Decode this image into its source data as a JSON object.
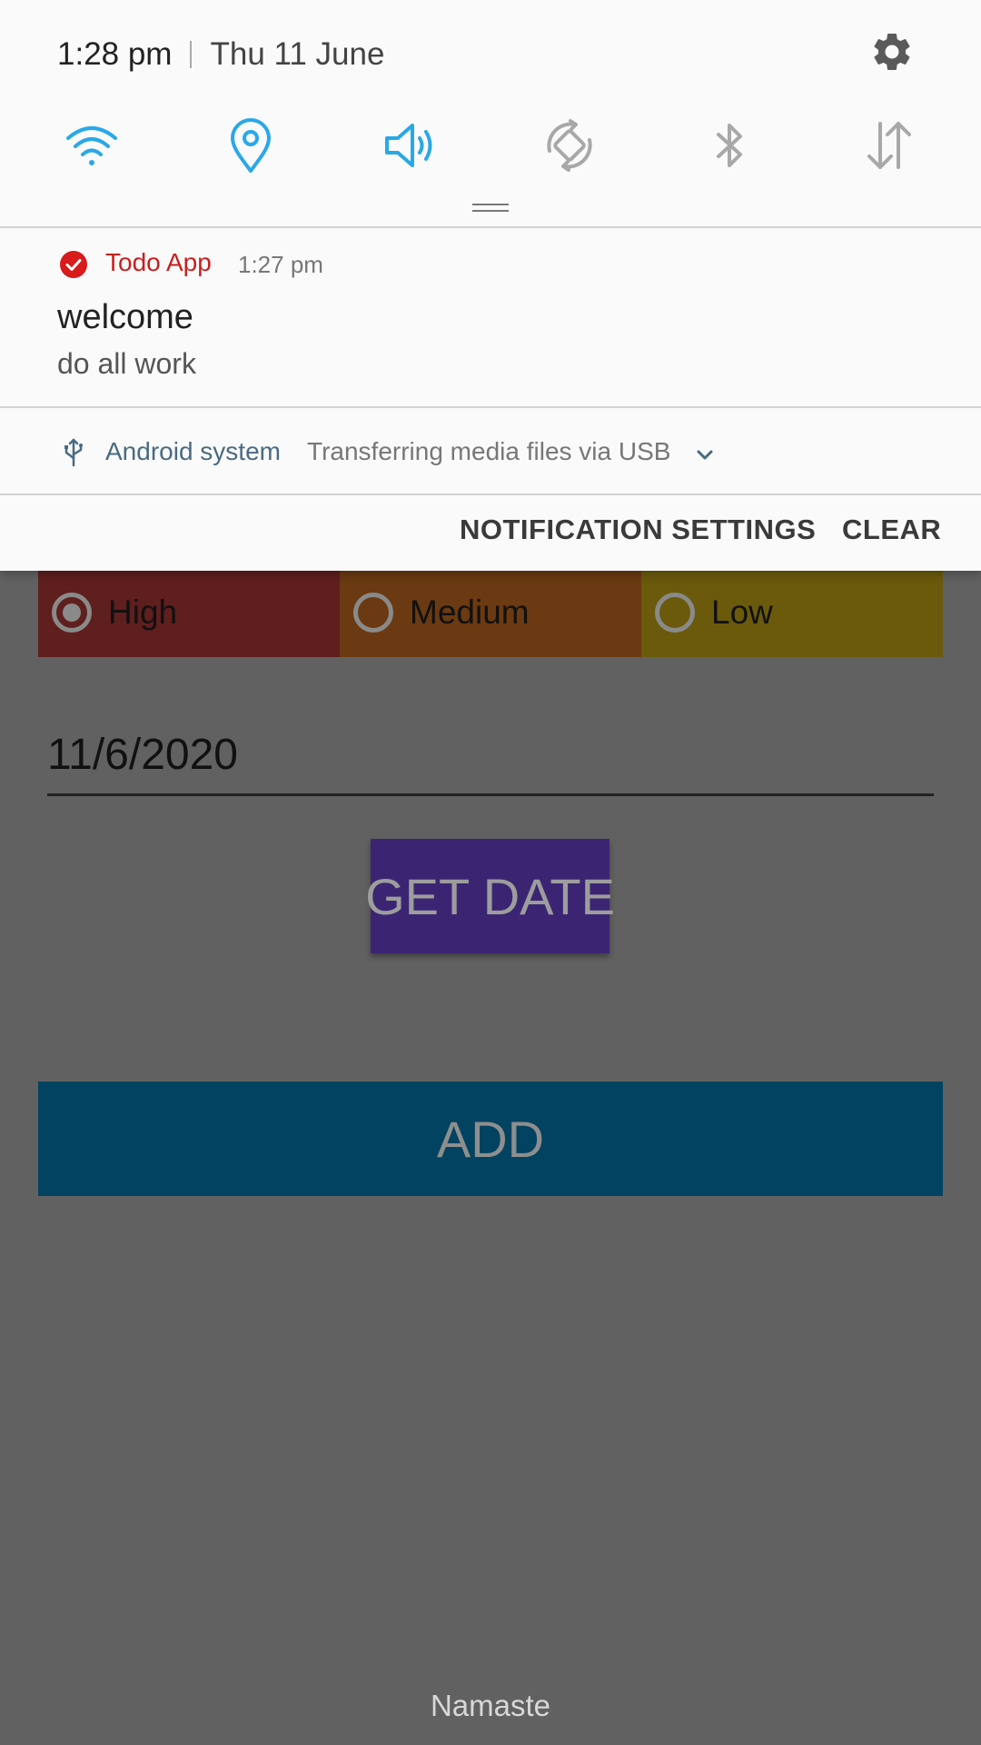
{
  "status": {
    "time": "1:28 pm",
    "date": "Thu 11 June"
  },
  "quick_settings": [
    {
      "name": "wifi-icon",
      "active": true
    },
    {
      "name": "location-icon",
      "active": true
    },
    {
      "name": "sound-icon",
      "active": true
    },
    {
      "name": "auto-rotate-icon",
      "active": false
    },
    {
      "name": "bluetooth-icon",
      "active": false
    },
    {
      "name": "mobile-data-icon",
      "active": false
    }
  ],
  "notification": {
    "app_name": "Todo App",
    "time": "1:27 pm",
    "title": "welcome",
    "body": "do all work"
  },
  "usb": {
    "app_name": "Android system",
    "text": "Transferring media files via USB"
  },
  "actions": {
    "settings_label": "NOTIFICATION SETTINGS",
    "clear_label": "CLEAR"
  },
  "app": {
    "priorities": [
      {
        "label": "High",
        "checked": true,
        "color": "#5f1f1e"
      },
      {
        "label": "Medium",
        "checked": false,
        "color": "#6b3a12"
      },
      {
        "label": "Low",
        "checked": false,
        "color": "#6b5a0c"
      }
    ],
    "date_value": "11/6/2020",
    "get_date_label": "GET DATE",
    "add_label": "ADD",
    "footer_text": "Namaste"
  },
  "colors": {
    "accent_active": "#29a8e8",
    "icon_inactive": "#a8a8a8",
    "notification_red": "#d81b1b",
    "get_date_bg": "#3b2573",
    "add_bg": "#014360"
  }
}
